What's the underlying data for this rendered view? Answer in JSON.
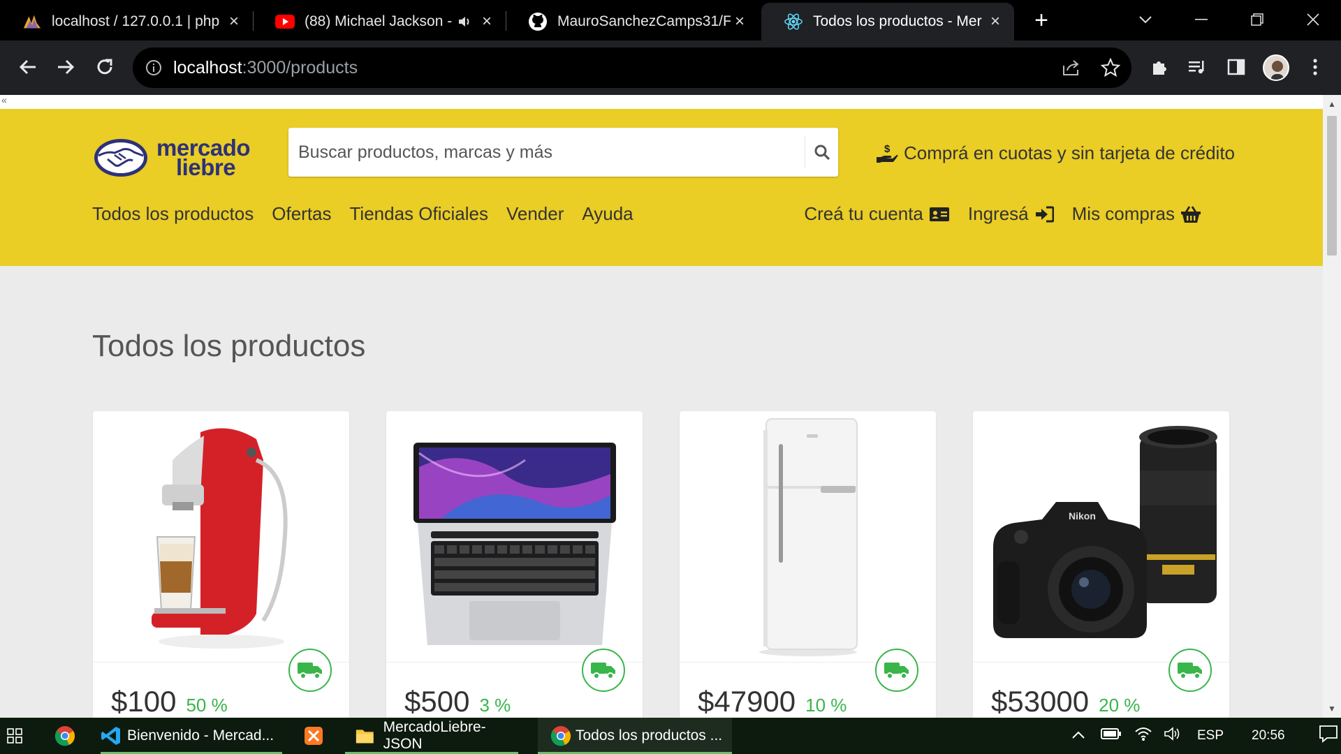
{
  "browser": {
    "tabs": [
      {
        "title": "localhost / 127.0.0.1 | php",
        "icon": "phpmyadmin-icon"
      },
      {
        "title": "(88) Michael Jackson -",
        "icon": "youtube-icon"
      },
      {
        "title": "MauroSanchezCamps31/F",
        "icon": "github-icon"
      },
      {
        "title": "Todos los productos - Mer",
        "icon": "react-icon"
      }
    ],
    "url_host": "localhost",
    "url_path": ":3000/products"
  },
  "page": {
    "collapse_marker": "«",
    "logo": {
      "line1": "mercado",
      "line2": "liebre"
    },
    "search": {
      "placeholder": "Buscar productos, marcas y más"
    },
    "promo": "Comprá en cuotas y sin tarjeta de crédito",
    "nav_left": [
      "Todos los productos",
      "Ofertas",
      "Tiendas Oficiales",
      "Vender",
      "Ayuda"
    ],
    "nav_right": {
      "register": "Creá tu cuenta",
      "login": "Ingresá",
      "purchases": "Mis compras"
    },
    "title": "Todos los productos",
    "products": [
      {
        "price": "$100",
        "discount": "50 %",
        "image": "coffee-machine"
      },
      {
        "price": "$500",
        "discount": "3 %",
        "image": "laptop"
      },
      {
        "price": "$47900",
        "discount": "10 %",
        "image": "refrigerator"
      },
      {
        "price": "$53000",
        "discount": "20 %",
        "image": "camera"
      }
    ]
  },
  "taskbar": {
    "items": [
      {
        "label": "Bienvenido - Mercad..."
      },
      {
        "label": "MercadoLiebre-JSON"
      },
      {
        "label": "Todos los productos ..."
      }
    ],
    "language": "ESP",
    "time": "20:56"
  },
  "colors": {
    "brand_yellow": "#eacd25",
    "brand_blue": "#2d3277",
    "discount_green": "#39b54a"
  }
}
